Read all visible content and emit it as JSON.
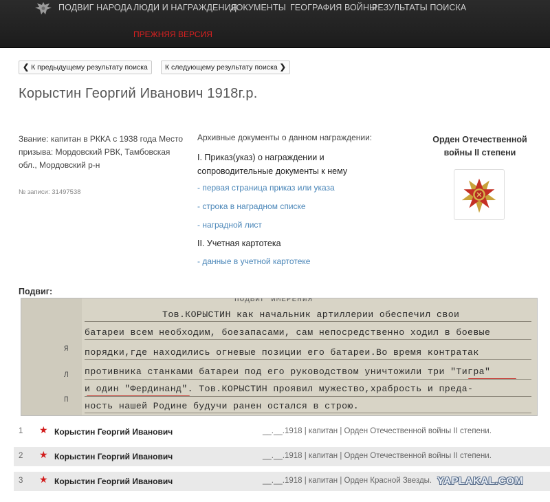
{
  "nav": {
    "items": [
      "ПОДВИГ НАРОДА",
      "ЛЮДИ И НАГРАЖДЕНИЯ",
      "ДОКУМЕНТЫ",
      "ГЕОГРАФИЯ ВОЙНЫ",
      "РЕЗУЛЬТАТЫ ПОИСКА"
    ],
    "prev_version": "ПРЕЖНЯЯ ВЕРСИЯ",
    "logo_icon": "eagle-emblem-icon"
  },
  "result_nav": {
    "prev_label": "К предыдущему результату поиска",
    "next_label": "К следующему результату поиска"
  },
  "person": {
    "title": "Корыстин Георгий Иванович 1918г.р.",
    "info": "Звание: капитан в РККА с 1938 года Место призыва: Мордовский РВК, Тамбовская обл., Мордовский р-н",
    "record_no": "№ записи: 31497538"
  },
  "documents": {
    "heading": "Архивные документы о данном награждении:",
    "section1_title": "I. Приказ(указ) о награждении и сопроводительные документы к нему",
    "links1": [
      "- первая страница приказ или указа",
      "- строка в наградном списке",
      "- наградной лист"
    ],
    "section2_title": "II. Учетная картотека",
    "links2": [
      "- данные в учетной картотеке"
    ]
  },
  "award": {
    "name": "Орден Отечественной войны II степени",
    "icon": "order-patriotic-war-icon"
  },
  "feat": {
    "label": "Подвиг:",
    "scan_header": "ПОДВИГ ИМЕРЕНИЯ",
    "scan_lines": [
      "Тов.КОРЫСТИН как начальник артиллерии обеспечил свои",
      "батареи всем необходим, боезапасами, сам непосредственно ходил в боевые",
      "порядки,где находились огневые позиции его батареи.Во время контратак",
      "противника станками батареи под его руководством уничтожили три \"Тигра\"",
      "и один \"Фердинанд\". Тов.КОРЫСТИН проявил мужество,храбрость и преда-",
      "ность нашей Родине будучи ранен остался в строю."
    ],
    "margin_letters": [
      "Я",
      "Л",
      "П"
    ]
  },
  "results": [
    {
      "num": "1",
      "name": "Корыстин Георгий Иванович",
      "meta": "__.__.1918 | капитан | Орден Отечественной войны II степени."
    },
    {
      "num": "2",
      "name": "Корыстин Георгий Иванович",
      "meta": "__.__.1918 | капитан | Орден Отечественной войны II степени."
    },
    {
      "num": "3",
      "name": "Корыстин Георгий Иванович",
      "meta": "__.__.1918 | капитан | Орден Красной Звезды."
    }
  ],
  "watermark": "YAPLAKAL.COM",
  "colors": {
    "nav_bg": "#222222",
    "accent_red": "#d92020",
    "link": "#4a86b8",
    "star": "#d21b1b"
  }
}
